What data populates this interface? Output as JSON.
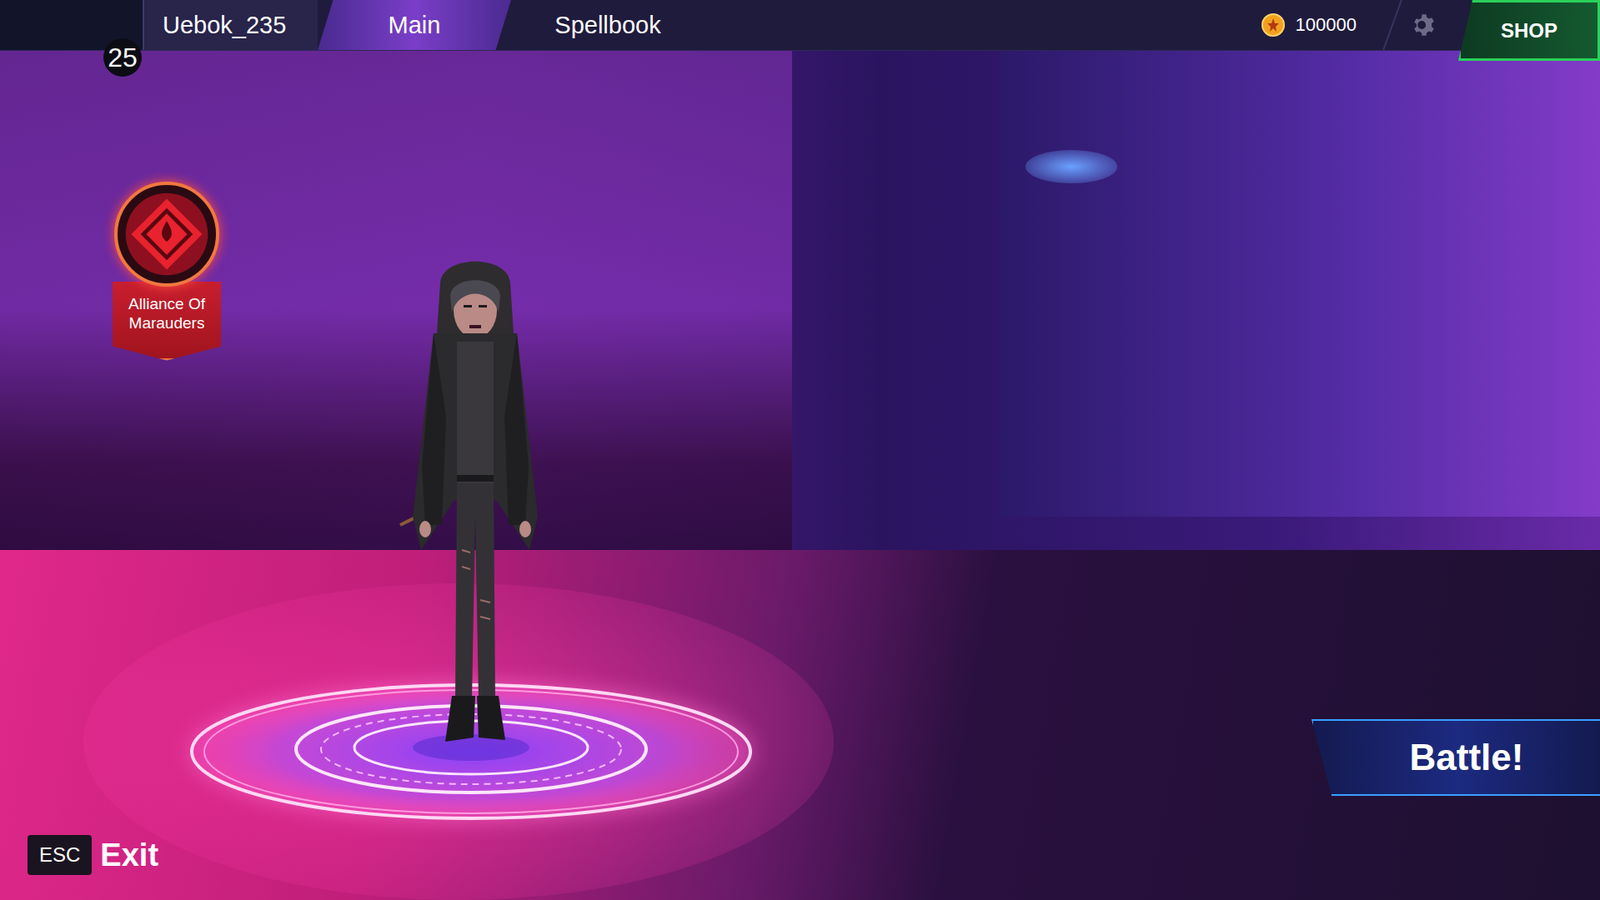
{
  "player": {
    "name": "Uebok_235",
    "level": "25"
  },
  "tabs": [
    {
      "label": "Main",
      "selected": true
    },
    {
      "label": "Spellbook",
      "selected": false
    }
  ],
  "currency": {
    "amount": "100000"
  },
  "shop": {
    "label": "SHOP"
  },
  "alliance": {
    "name": "Alliance Of Marauders"
  },
  "battle": {
    "label": "Battle!"
  },
  "exit": {
    "key": "ESC",
    "label": "Exit"
  }
}
